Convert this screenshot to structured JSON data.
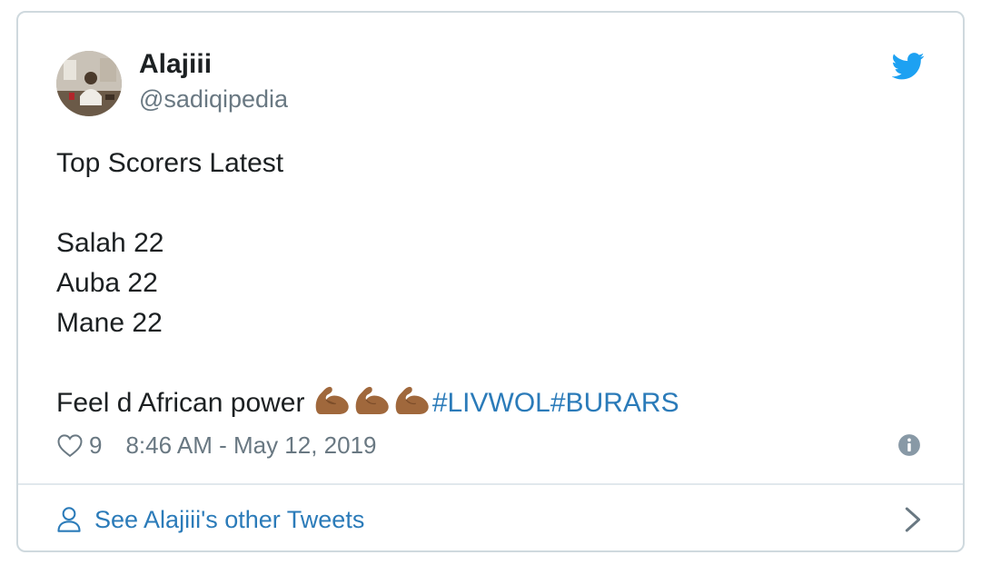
{
  "author": {
    "name": "Alajiii",
    "handle": "@sadiqipedia"
  },
  "tweet": {
    "lines": [
      "Top Scorers Latest",
      "",
      "Salah 22",
      "Auba 22",
      "Mane 22",
      ""
    ],
    "last_line_text": "Feel d African power ",
    "emoji": "flexed-biceps-medium-dark-skin-tone",
    "emoji_count": 3,
    "hashtags": [
      "#LIVWOL",
      "#BURARS"
    ]
  },
  "meta": {
    "like_count": "9",
    "timestamp": "8:46 AM - May 12, 2019"
  },
  "footer": {
    "link_text": "See Alajiii's other Tweets"
  },
  "colors": {
    "accent": "#2b7bb9",
    "twitter_blue": "#1da1f2",
    "muted": "#697882",
    "border": "#cfd9de"
  },
  "icons": [
    "twitter-bird-icon",
    "heart-icon",
    "info-icon",
    "person-icon",
    "chevron-right-icon"
  ]
}
